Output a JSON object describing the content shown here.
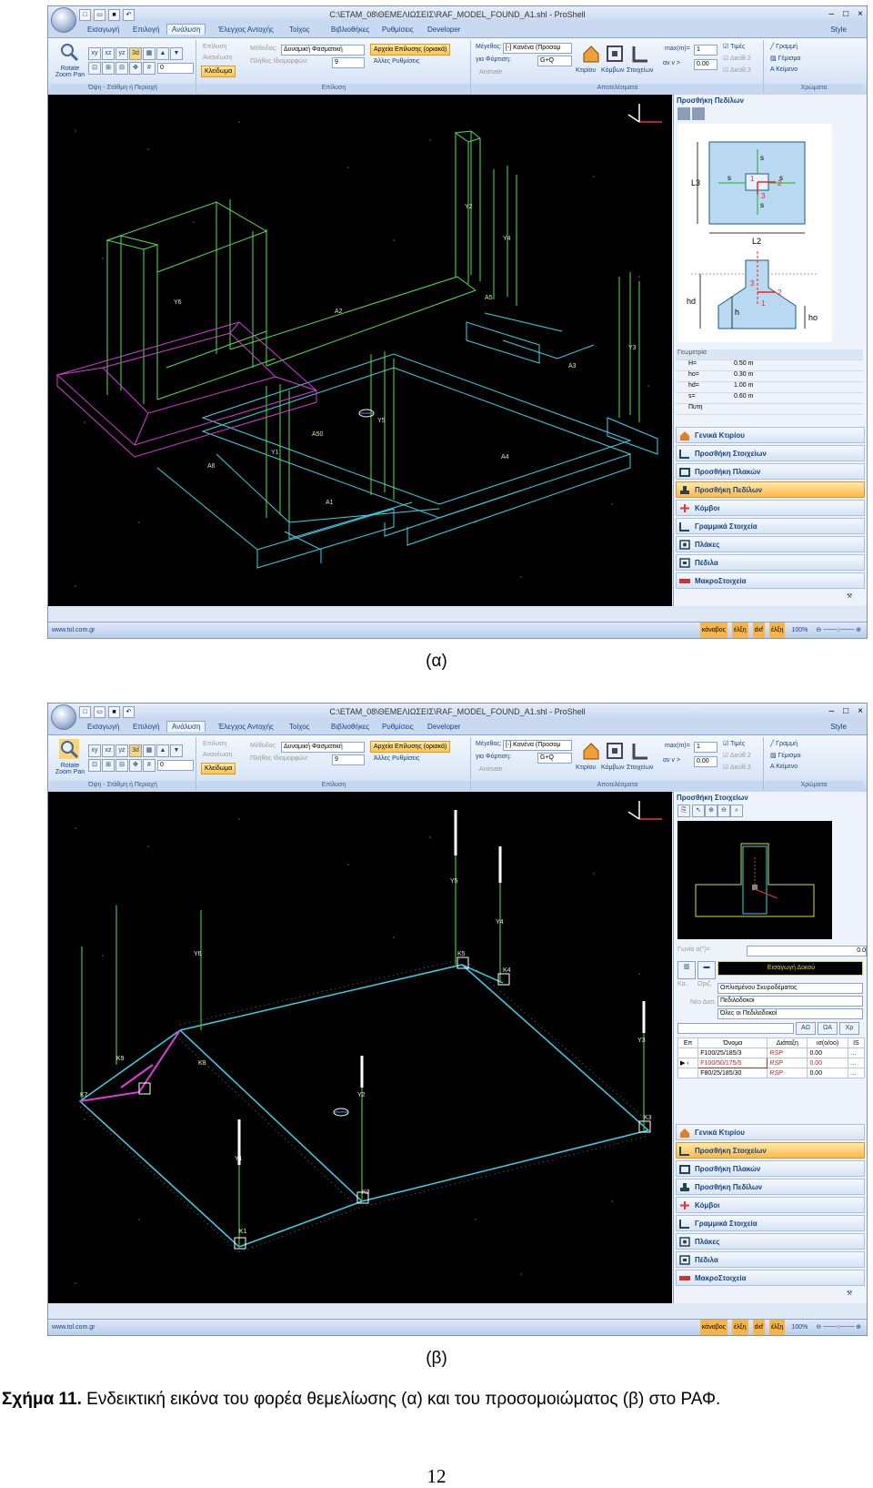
{
  "app": {
    "window_title": "C:\\ETAM_08\\ΘΕΜΕΛΙΩΣΕΙΣ\\RAF_MODEL_FOUND_A1.shl - ProShell",
    "tabs": [
      "Εισαγωγή",
      "Επιλογή",
      "Ανάλυση",
      "Έλεγχος Αντοχής",
      "Τοίχος",
      "Βιβλιοθήκες",
      "Ρυθμίσεις",
      "Developer"
    ],
    "active_tab": "Ανάλυση",
    "style_label": "Style",
    "ribbon": {
      "rotate_zoom_label": "Rotate Zoom Pan",
      "view_buttons": [
        "xy",
        "xz",
        "yz",
        "3d"
      ],
      "view_group": "Όψη - Στάθμη ή Περιοχή",
      "epilysi": "Επίλυση",
      "ananeosi": "Ανανέωση",
      "kleidoma": "Κλείδωμα",
      "methodos_label": "Μέθοδος:",
      "methodos_value": "Δυναμική Φασματική",
      "plithos_label": "Πλήθος Ιδιομορφών:",
      "plithos_value": "9",
      "arxeia_btn": "Αρχεία Επίλυσης (οριακά)",
      "alles_rythmiseis": "Άλλες Ρυθμίσεις",
      "analysis_group": "Επίλυση",
      "megethos_label": "Μέγεθος:",
      "megethos_value": "[-] Κανένα (Προσομ",
      "fortisi_label": "για Φόρτιση:",
      "fortisi_value": "G+Q",
      "animate": "Animate",
      "results_icons": [
        "Κτιρίου",
        "Κόμβων",
        "Στοιχείων"
      ],
      "max_label": "max(m)=",
      "max_value": "1",
      "an_label": "αν v >",
      "an_value": "0.00",
      "results_group": "Αποτελέσματα",
      "checks": [
        "Τιμές",
        "Διεύθ.2",
        "Διεύθ.3"
      ],
      "color_items": [
        "Γραμμή",
        "Γέμισμα",
        "Κείμενο"
      ],
      "colors_group": "Χρώματα"
    },
    "status": {
      "url": "www.tol.com.gr",
      "items": [
        "κάναβος",
        "έλξη",
        "dxf",
        "έλξη"
      ],
      "zoom": "100%"
    },
    "nav_buttons": [
      "Γενικά Κτιρίου",
      "Προσθήκη Στοιχείων",
      "Προσθήκη Πλακών",
      "Προσθήκη Πεδίλων",
      "Κόμβοι",
      "Γραμμικά Στοιχεία",
      "Πλάκες",
      "Πέδιλα",
      "ΜακροΣτοιχεία"
    ]
  },
  "screenshot_a": {
    "panel_title": "Προσθήκη Πεδίλων",
    "selected_nav": "Προσθήκη Πεδίλων",
    "diagram_labels": {
      "l3": "L3",
      "l2": "L2",
      "s": "s",
      "hd": "hd",
      "h": "h",
      "ho": "ho",
      "n1": "1",
      "n2": "2",
      "n3": "3"
    },
    "props_header": "Γεωμετρία",
    "props": [
      {
        "k": "H=",
        "v": "0.50 m"
      },
      {
        "k": "ho=",
        "v": "0.30 m"
      },
      {
        "k": "hd=",
        "v": "1.00 m"
      },
      {
        "k": "s=",
        "v": "0.60 m"
      },
      {
        "k": "Πυτη",
        "v": ""
      }
    ],
    "model_labels": [
      "Y1",
      "Y2",
      "Y3",
      "Y4",
      "Y5",
      "Y6",
      "A1",
      "A2",
      "A3",
      "A4",
      "A5",
      "A6",
      "A50"
    ]
  },
  "screenshot_b": {
    "panel_title": "Προσθήκη Στοιχείων",
    "selected_nav": "Προσθήκη Στοιχείων",
    "gonia_label": "Γωνία α(°)=",
    "gonia_value": "0.0",
    "eisagogi_btn": "Εισαγωγή Δοκού",
    "small_btns": [
      "Κα..",
      "Οριζ.",
      "Νέο Διατ."
    ],
    "selects": [
      "Οπλισμένου Σκυροδέματος",
      "Πεδιλοδοκοί",
      "Όλες οι Πεδιλοδοκοί"
    ],
    "mini_btns": [
      "ΑΩ",
      "ΩΑ",
      "Χρ"
    ],
    "table_headers": [
      "Επ",
      "Όνομα",
      "Διάταξη",
      "ισ(ο/οο)",
      "IS"
    ],
    "table_rows": [
      {
        "name": "F100/25/185/3",
        "diat": "RSP",
        "val": "0.00"
      },
      {
        "name": "F100/50/175/5",
        "diat": "RSP",
        "val": "0.00"
      },
      {
        "name": "F80/25/185/30",
        "diat": "RSP",
        "val": "0.00"
      }
    ],
    "model_labels": [
      "K1",
      "K2",
      "K3",
      "K4",
      "K5",
      "K7",
      "K8",
      "K9",
      "Y1",
      "Y2",
      "Y3",
      "Y4",
      "Y5",
      "Y6"
    ]
  },
  "captions": {
    "a": "(α)",
    "b": "(β)",
    "fig_bold": "Σχήμα 11.",
    "fig_text": " Ενδεικτική εικόνα του φορέα θεμελίωσης (α) και του προσομοιώματος (β) στο ΡΑΦ.",
    "page_number": "12"
  }
}
